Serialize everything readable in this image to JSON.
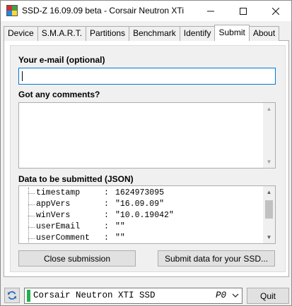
{
  "window": {
    "title": "SSD-Z 16.09.09 beta - Corsair Neutron XTi",
    "app_icon": "ssdz-app-icon",
    "controls": [
      "minimize-icon",
      "maximize-icon",
      "close-icon"
    ]
  },
  "tabs": [
    {
      "label": "Device",
      "active": false
    },
    {
      "label": "S.M.A.R.T.",
      "active": false
    },
    {
      "label": "Partitions",
      "active": false
    },
    {
      "label": "Benchmark",
      "active": false
    },
    {
      "label": "Identify",
      "active": false
    },
    {
      "label": "Submit",
      "active": true
    },
    {
      "label": "About",
      "active": false
    }
  ],
  "submit": {
    "email_label": "Your e-mail (optional)",
    "email_value": "",
    "comments_label": "Got any comments?",
    "comments_value": "",
    "json_label": "Data to be submitted (JSON)",
    "json_rows": [
      {
        "key": "timestamp",
        "sep": ":",
        "value": "1624973095"
      },
      {
        "key": "appVers",
        "sep": ":",
        "value": "\"16.09.09\""
      },
      {
        "key": "winVers",
        "sep": ":",
        "value": "\"10.0.19042\""
      },
      {
        "key": "userEmail",
        "sep": ":",
        "value": "\"\""
      },
      {
        "key": "userComment",
        "sep": ":",
        "value": "\"\""
      }
    ],
    "close_button": "Close submission",
    "submit_button": "Submit data for your SSD..."
  },
  "footer": {
    "refresh_icon": "refresh-icon",
    "drive_name": "Corsair Neutron XTI SSD",
    "drive_port": "P0",
    "quit_button": "Quit"
  },
  "colors": {
    "focus_border": "#0078d7",
    "status_led": "#22b14c"
  }
}
